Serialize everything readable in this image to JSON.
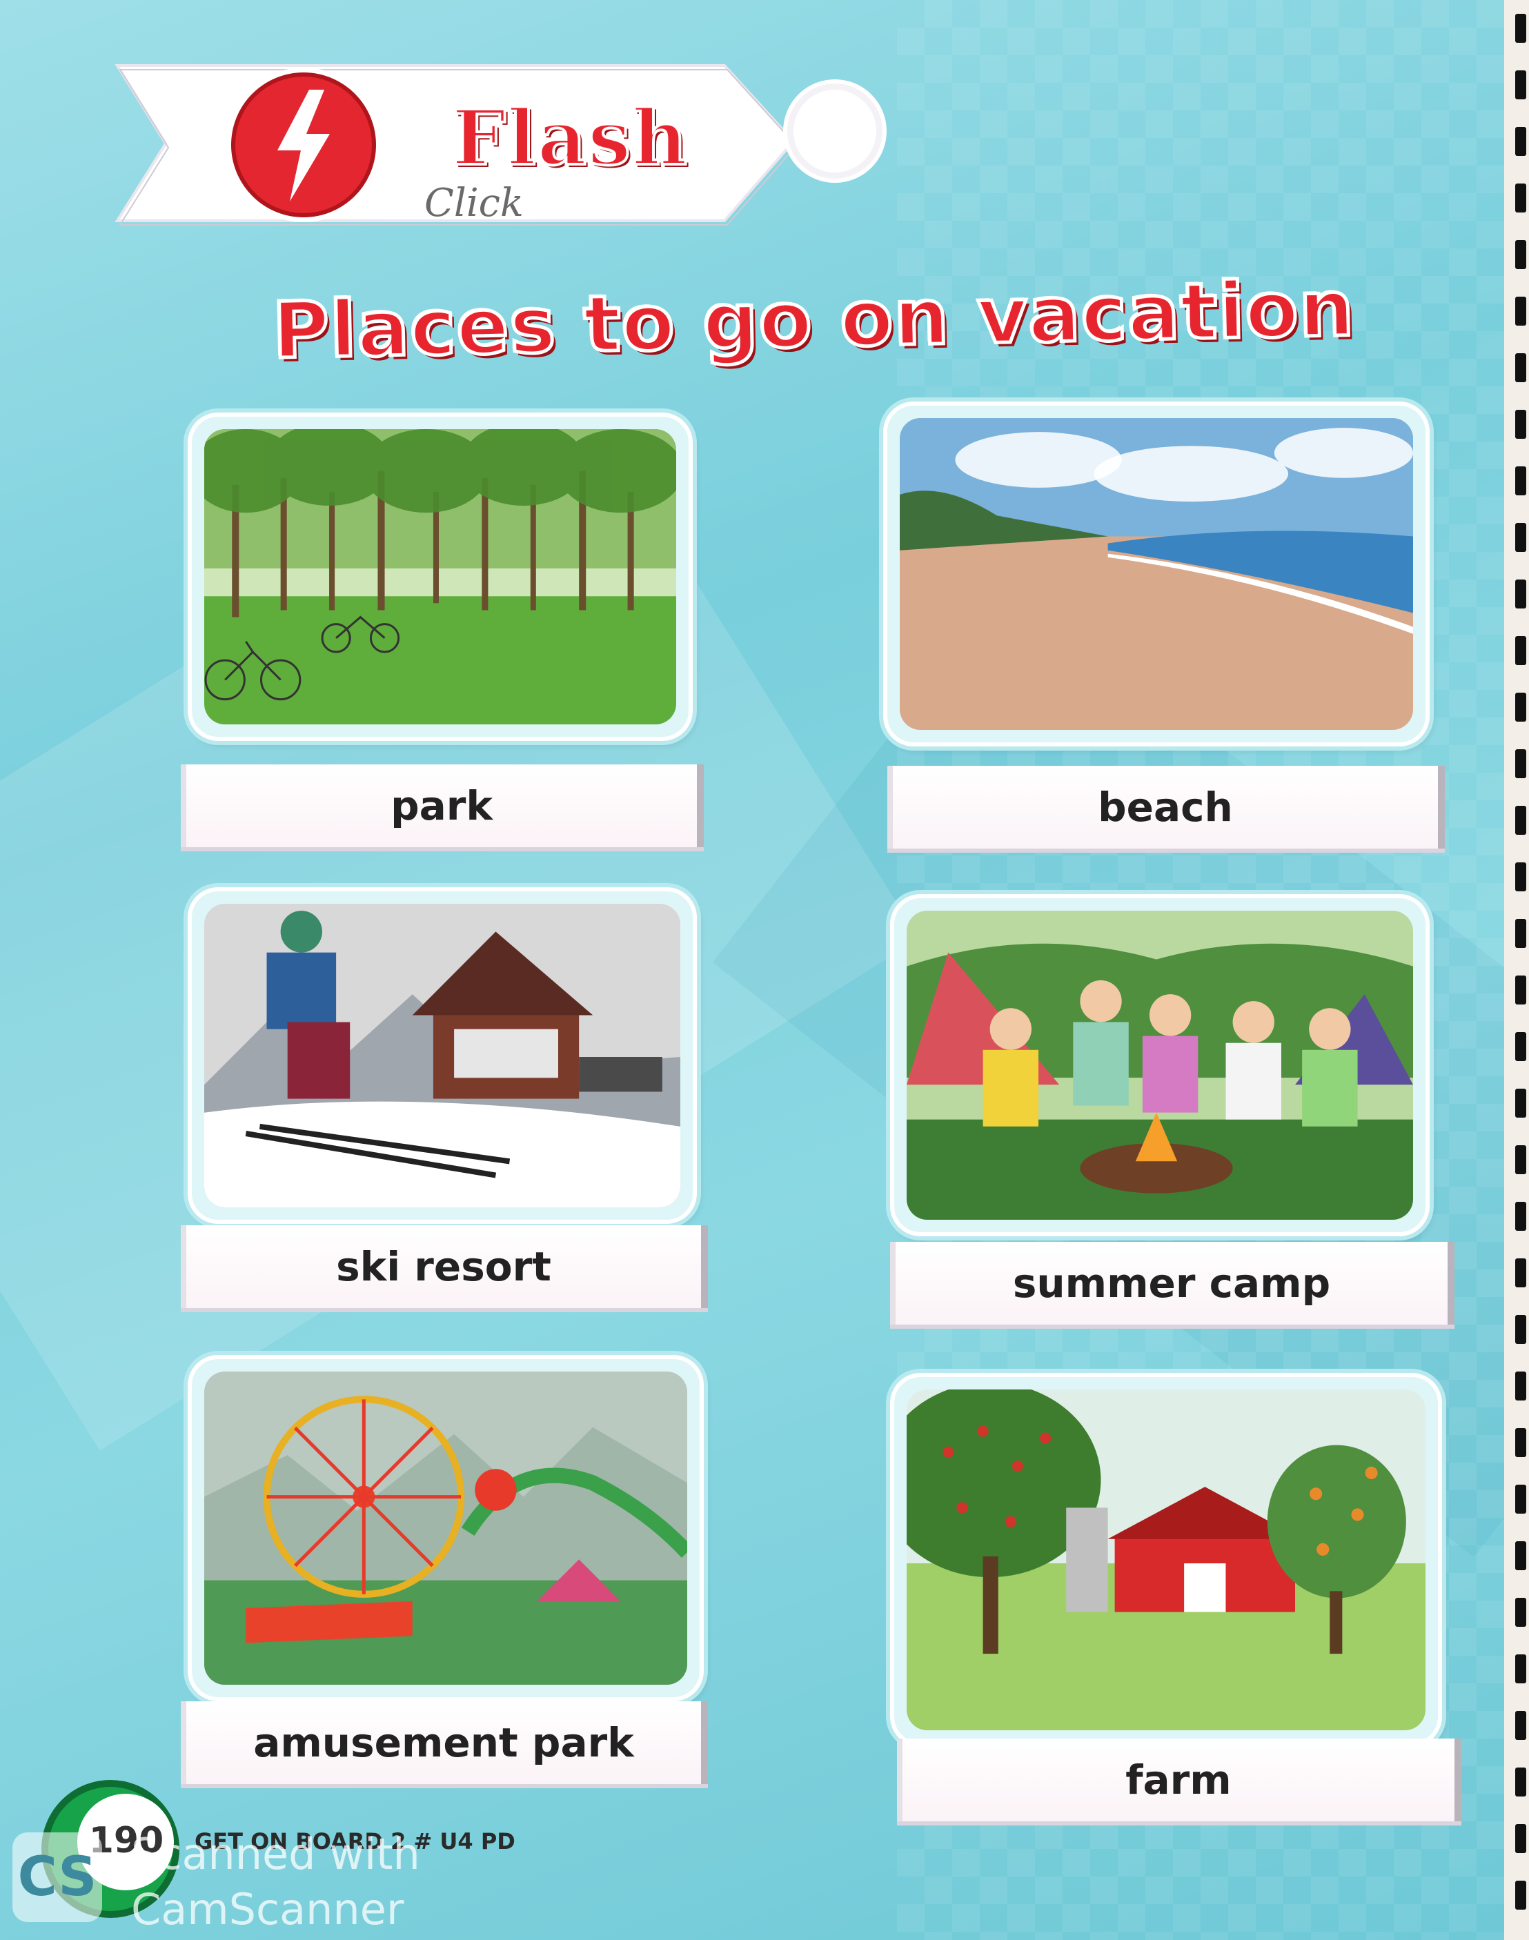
{
  "header": {
    "badge_label": "Flash",
    "handwritten_note": "Click"
  },
  "title": "Places to go on vacation",
  "places": [
    {
      "label": "park",
      "icon": "park-scene"
    },
    {
      "label": "beach",
      "icon": "beach-scene"
    },
    {
      "label": "ski resort",
      "icon": "ski-resort-scene"
    },
    {
      "label": "summer camp",
      "icon": "summer-camp-scene"
    },
    {
      "label": "amusement park",
      "icon": "amusement-park-scene"
    },
    {
      "label": "farm",
      "icon": "farm-scene"
    }
  ],
  "footer": {
    "page_number": "190",
    "book_code": "GET ON BOARD 2  #  U4 PD",
    "watermark_line1": "Scanned with",
    "watermark_line2": "CamScanner",
    "scanner_logo": "CS"
  },
  "colors": {
    "background": "#79cfdc",
    "title_red": "#e7252f",
    "badge_red": "#e7252f",
    "footer_green": "#16a34a"
  }
}
